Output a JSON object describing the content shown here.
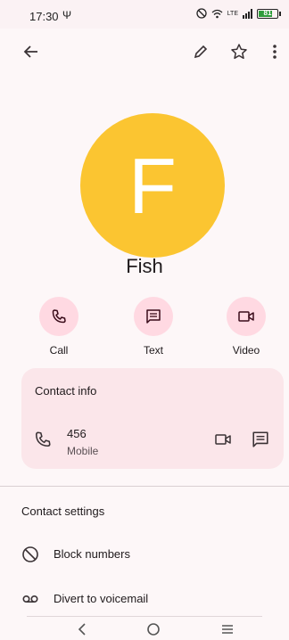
{
  "status_bar": {
    "time": "17:30",
    "usb_symbol": "Ψ",
    "network_label": "LTE",
    "battery_label": "81",
    "battery_level": 0.81,
    "battery_color": "#2e9d3c"
  },
  "app_bar": {
    "icons": [
      "back-arrow-icon",
      "edit-pencil-icon",
      "star-outline-icon",
      "more-vert-icon"
    ]
  },
  "contact": {
    "avatar_letter": "F",
    "avatar_color": "#fbc531",
    "name": "Fish"
  },
  "actions": [
    {
      "label": "Call",
      "icon": "phone-icon"
    },
    {
      "label": "Text",
      "icon": "message-icon"
    },
    {
      "label": "Video",
      "icon": "videocam-icon"
    }
  ],
  "contact_info": {
    "title": "Contact info",
    "number": "456",
    "type": "Mobile"
  },
  "contact_settings": {
    "title": "Contact settings",
    "rows": [
      {
        "label": "Block numbers",
        "icon": "block-icon"
      },
      {
        "label": "Divert to voicemail",
        "icon": "voicemail-icon"
      }
    ]
  },
  "nav": {
    "icons": [
      "nav-back-icon",
      "nav-home-icon",
      "nav-recents-icon"
    ]
  },
  "colors": {
    "background": "#fdf7f8",
    "action_circle": "#ffd9e2",
    "card": "#fbe6ea"
  }
}
